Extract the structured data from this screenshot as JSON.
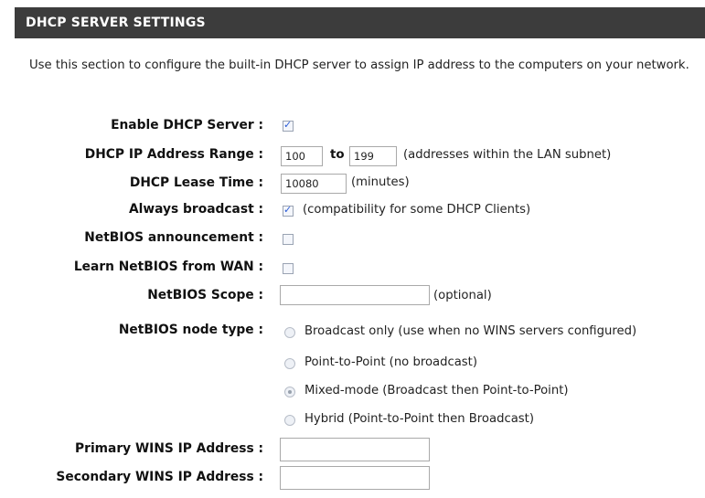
{
  "header": {
    "title": "DHCP SERVER SETTINGS"
  },
  "description": "Use this section to configure the built-in DHCP server to assign IP address to the computers on your network.",
  "rows": {
    "enable_dhcp": {
      "label": "Enable DHCP Server :",
      "checked": true
    },
    "ip_range": {
      "label": "DHCP IP Address Range :",
      "start": "100",
      "to_label": "to",
      "end": "199",
      "hint": "(addresses within the LAN subnet)"
    },
    "lease_time": {
      "label": "DHCP Lease Time :",
      "value": "10080",
      "unit": "(minutes)"
    },
    "always_broadcast": {
      "label": "Always broadcast :",
      "checked": true,
      "hint": "(compatibility for some DHCP Clients)"
    },
    "netbios_announcement": {
      "label": "NetBIOS announcement :",
      "checked": false
    },
    "learn_netbios": {
      "label": "Learn NetBIOS from WAN :",
      "checked": false
    },
    "netbios_scope": {
      "label": "NetBIOS Scope :",
      "value": "",
      "hint": "(optional)"
    },
    "netbios_node": {
      "label": "NetBIOS node type :",
      "options": [
        {
          "label": "Broadcast only (use when no WINS servers configured)",
          "checked": false
        },
        {
          "label": "Point-to-Point (no broadcast)",
          "checked": false
        },
        {
          "label": "Mixed-mode (Broadcast then Point-to-Point)",
          "checked": true
        },
        {
          "label": "Hybrid (Point-to-Point then Broadcast)",
          "checked": false
        }
      ]
    },
    "primary_wins": {
      "label": "Primary WINS IP Address :",
      "value": ""
    },
    "secondary_wins": {
      "label": "Secondary WINS IP Address :",
      "value": ""
    }
  }
}
